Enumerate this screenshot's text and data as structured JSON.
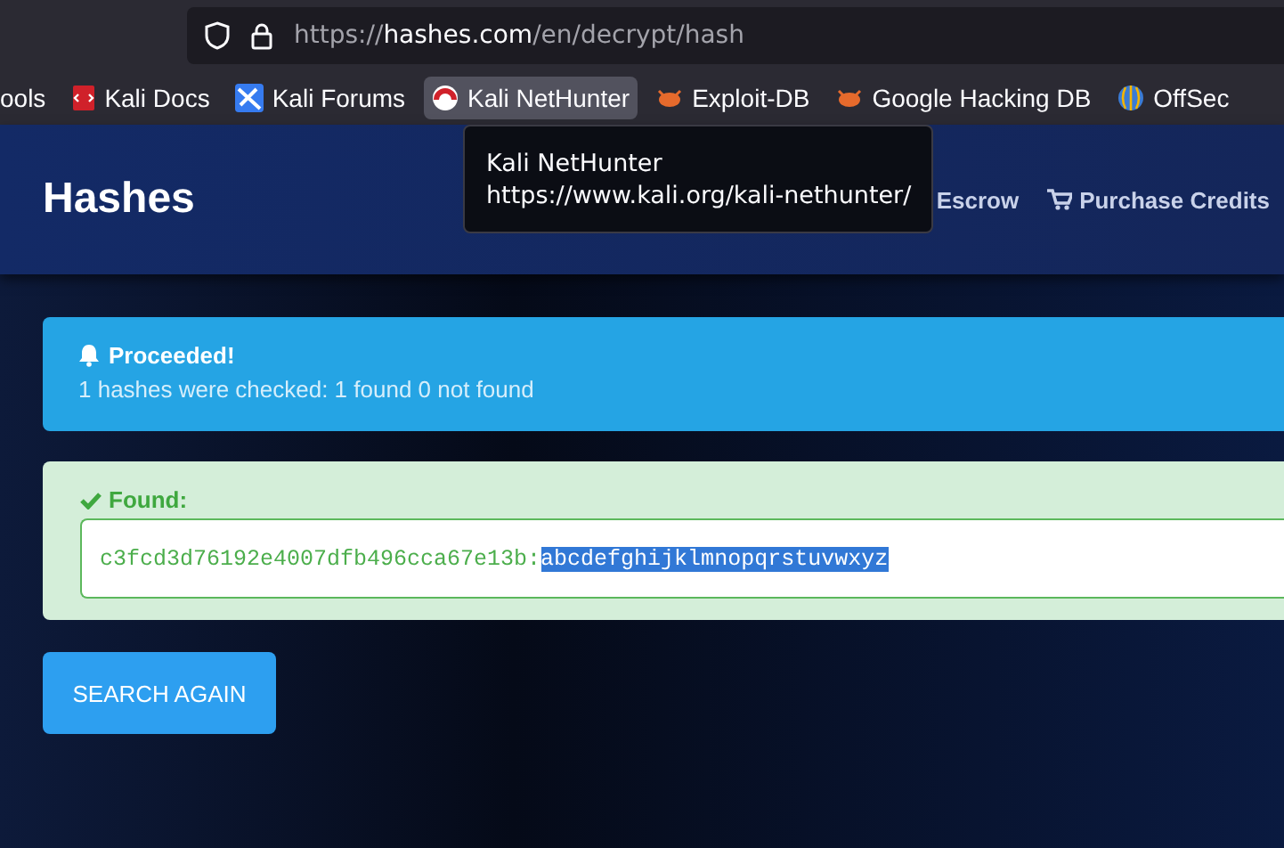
{
  "browser": {
    "url_host": "hashes.com",
    "url_scheme": "https://",
    "url_path": "/en/decrypt/hash",
    "bookmarks": [
      {
        "label": "ools",
        "kind": "none",
        "hovered": false
      },
      {
        "label": "Kali Docs",
        "kind": "docs",
        "hovered": false
      },
      {
        "label": "Kali Forums",
        "kind": "forums",
        "hovered": false
      },
      {
        "label": "Kali NetHunter",
        "kind": "nethunter",
        "hovered": true
      },
      {
        "label": "Exploit-DB",
        "kind": "bug",
        "hovered": false
      },
      {
        "label": "Google Hacking DB",
        "kind": "bug",
        "hovered": false
      },
      {
        "label": "OffSec",
        "kind": "offsec",
        "hovered": false
      }
    ],
    "tooltip": {
      "title": "Kali NetHunter",
      "url": "https://www.kali.org/kali-nethunter/"
    }
  },
  "header": {
    "brand": "Hashes",
    "nav": [
      {
        "label": "Escrow",
        "kind": "plain"
      },
      {
        "label": "Purchase Credits",
        "kind": "cart"
      }
    ]
  },
  "alert": {
    "title": "Proceeded!",
    "message": "1 hashes were checked: 1 found 0 not found"
  },
  "found": {
    "label": "Found:",
    "hash": "c3fcd3d76192e4007dfb496cca67e13b:",
    "plain": "abcdefghijklmnopqrstuvwxyz",
    "plain_selected": true
  },
  "button": "SEARCH AGAIN"
}
